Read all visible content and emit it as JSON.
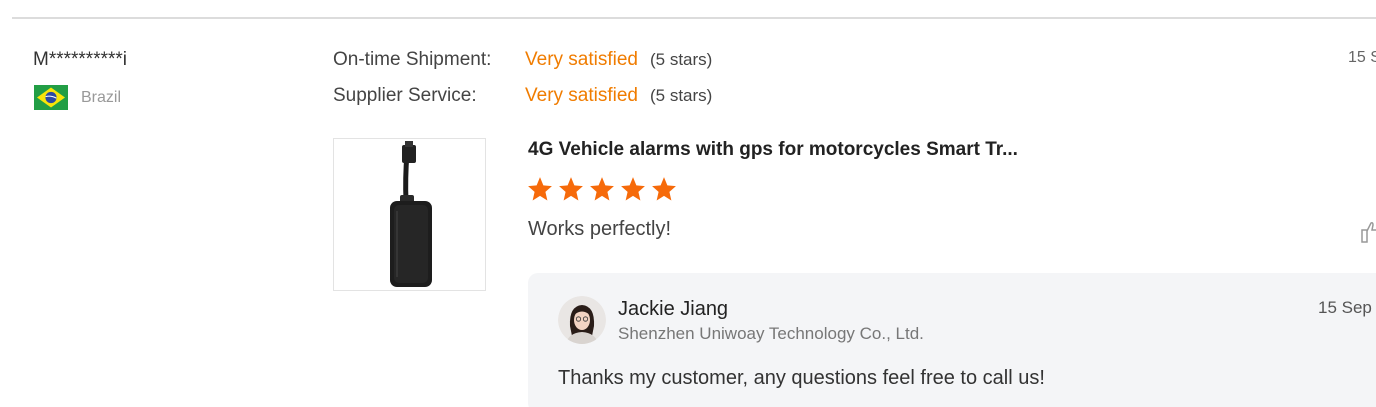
{
  "review": {
    "buyer_name": "M**********i",
    "country": "Brazil",
    "flag_icon": "brazil-flag-icon",
    "date": "15 S",
    "ratings": [
      {
        "label": "On-time Shipment:",
        "value": "Very satisfied",
        "stars_text": "(5 stars)"
      },
      {
        "label": "Supplier Service:",
        "value": "Very satisfied",
        "stars_text": "(5 stars)"
      }
    ],
    "product_title": "4G Vehicle alarms with gps for motorcycles Smart Tr...",
    "product_image_icon": "gps-tracker-device-image",
    "star_rating": 5,
    "star_color": "#f66a0a",
    "text": "Works perfectly!",
    "like_icon": "thumbs-up-icon"
  },
  "reply": {
    "name": "Jackie Jiang",
    "company": "Shenzhen Uniwoay Technology Co., Ltd.",
    "date": "15 Sep",
    "text": "Thanks my customer, any questions feel free to call us!"
  },
  "colors": {
    "accent": "#f07c00",
    "reply_background": "#f4f5f7"
  }
}
